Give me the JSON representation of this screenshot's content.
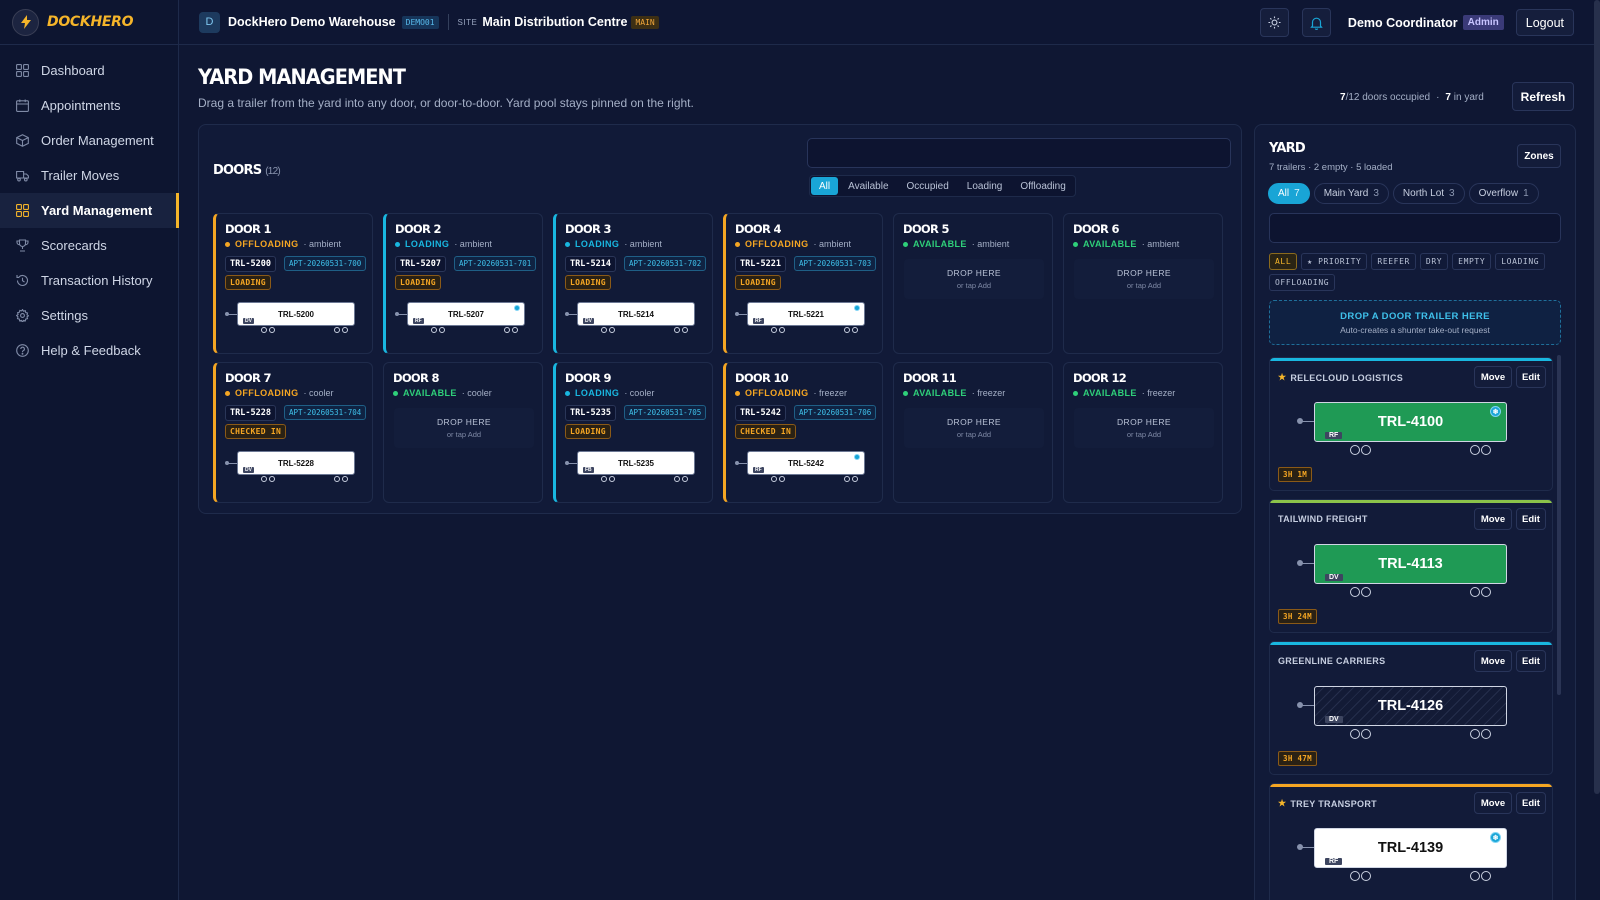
{
  "app": {
    "name": "DOCKHERO"
  },
  "sidebar": {
    "items": [
      {
        "label": "Dashboard",
        "icon": "grid-icon"
      },
      {
        "label": "Appointments",
        "icon": "calendar-icon"
      },
      {
        "label": "Order Management",
        "icon": "box-icon"
      },
      {
        "label": "Trailer Moves",
        "icon": "truck-icon"
      },
      {
        "label": "Yard Management",
        "icon": "grid-icon",
        "active": true
      },
      {
        "label": "Scorecards",
        "icon": "trophy-icon"
      },
      {
        "label": "Transaction History",
        "icon": "history-icon"
      },
      {
        "label": "Settings",
        "icon": "gear-icon"
      },
      {
        "label": "Help & Feedback",
        "icon": "help-icon"
      }
    ]
  },
  "topbar": {
    "warehouse_initial": "D",
    "warehouse_name": "DockHero Demo Warehouse",
    "warehouse_code": "DEMO01",
    "site_label": "SITE",
    "site_name": "Main Distribution Centre",
    "site_tag": "MAIN",
    "user_name": "Demo Coordinator",
    "user_role": "Admin",
    "logout_label": "Logout"
  },
  "page": {
    "title": "YARD MANAGEMENT",
    "subtitle": "Drag a trailer from the yard into any door, or door-to-door. Yard pool stays pinned on the right.",
    "doors_occupied": "7",
    "doors_total": "/12 doors occupied",
    "stats_sep": "·",
    "in_yard": "7",
    "in_yard_label": " in yard",
    "refresh_label": "Refresh"
  },
  "doors": {
    "title": "DOORS",
    "count": "(12)",
    "search_placeholder": "",
    "filters": [
      "All",
      "Available",
      "Occupied",
      "Loading",
      "Offloading"
    ],
    "active_filter": "All",
    "drop_text": "DROP HERE",
    "drop_sub": "or tap Add",
    "items": [
      {
        "name": "DOOR 1",
        "status": "OFFLOADING",
        "kind": "off",
        "zone": "· ambient",
        "trailer": "TRL-5200",
        "apt": "APT-20260531-700",
        "pill": "LOADING",
        "label": "DV",
        "reefer": false
      },
      {
        "name": "DOOR 2",
        "status": "LOADING",
        "kind": "load",
        "zone": "· ambient",
        "trailer": "TRL-5207",
        "apt": "APT-20260531-701",
        "pill": "LOADING",
        "label": "RF",
        "reefer": true
      },
      {
        "name": "DOOR 3",
        "status": "LOADING",
        "kind": "load",
        "zone": "· ambient",
        "trailer": "TRL-5214",
        "apt": "APT-20260531-702",
        "pill": "LOADING",
        "label": "DV",
        "reefer": false
      },
      {
        "name": "DOOR 4",
        "status": "OFFLOADING",
        "kind": "off",
        "zone": "· ambient",
        "trailer": "TRL-5221",
        "apt": "APT-20260531-703",
        "pill": "LOADING",
        "label": "RF",
        "reefer": true
      },
      {
        "name": "DOOR 5",
        "status": "AVAILABLE",
        "kind": "av",
        "zone": "· ambient"
      },
      {
        "name": "DOOR 6",
        "status": "AVAILABLE",
        "kind": "av",
        "zone": "· ambient"
      },
      {
        "name": "DOOR 7",
        "status": "OFFLOADING",
        "kind": "off",
        "zone": "· cooler",
        "trailer": "TRL-5228",
        "apt": "APT-20260531-704",
        "pill": "CHECKED IN",
        "label": "DV",
        "reefer": false
      },
      {
        "name": "DOOR 8",
        "status": "AVAILABLE",
        "kind": "av",
        "zone": "· cooler"
      },
      {
        "name": "DOOR 9",
        "status": "LOADING",
        "kind": "load",
        "zone": "· cooler",
        "trailer": "TRL-5235",
        "apt": "APT-20260531-705",
        "pill": "LOADING",
        "label": "FB",
        "reefer": false
      },
      {
        "name": "DOOR 10",
        "status": "OFFLOADING",
        "kind": "off",
        "zone": "· freezer",
        "trailer": "TRL-5242",
        "apt": "APT-20260531-706",
        "pill": "CHECKED IN",
        "label": "RF",
        "reefer": true
      },
      {
        "name": "DOOR 11",
        "status": "AVAILABLE",
        "kind": "av",
        "zone": "· freezer"
      },
      {
        "name": "DOOR 12",
        "status": "AVAILABLE",
        "kind": "av",
        "zone": "· freezer"
      }
    ]
  },
  "yard": {
    "title": "YARD",
    "summary": "7 trailers · 2 empty · 5 loaded",
    "zones_label": "Zones",
    "tabs": [
      {
        "label": "All",
        "count": "7",
        "active": true
      },
      {
        "label": "Main Yard",
        "count": "3"
      },
      {
        "label": "North Lot",
        "count": "3"
      },
      {
        "label": "Overflow",
        "count": "1"
      }
    ],
    "search_placeholder": "",
    "filters": [
      "ALL",
      "★ PRIORITY",
      "REEFER",
      "DRY",
      "EMPTY",
      "LOADING",
      "OFFLOADING"
    ],
    "active_filter": "ALL",
    "drop_title": "DROP A DOOR TRAILER HERE",
    "drop_sub": "Auto-creates a shunter take-out request",
    "move_label": "Move",
    "edit_label": "Edit",
    "cards": [
      {
        "carrier": "RELECLOUD LOGISTICS",
        "priority": true,
        "trailer": "TRL-4100",
        "label": "RF",
        "style": "green",
        "reefer": true,
        "dwell": "3H 1M",
        "accent": "#19b7e0"
      },
      {
        "carrier": "TAILWIND FREIGHT",
        "priority": false,
        "trailer": "TRL-4113",
        "label": "DV",
        "style": "green",
        "reefer": false,
        "dwell": "3H 24M",
        "accent": "#8bc34a"
      },
      {
        "carrier": "GREENLINE CARRIERS",
        "priority": false,
        "trailer": "TRL-4126",
        "label": "DV",
        "style": "empty",
        "reefer": false,
        "dwell": "3H 47M",
        "accent": "#19b7e0"
      },
      {
        "carrier": "TREY TRANSPORT",
        "priority": true,
        "trailer": "TRL-4139",
        "label": "RF",
        "style": "white",
        "reefer": true,
        "dwell": "",
        "accent": "#f5a623"
      }
    ]
  },
  "colors": {
    "accent": "#f5b52a",
    "cyan": "#19a5d6",
    "offloading": "#f5a623",
    "loading": "#19b7e0",
    "available": "#2fd07a"
  }
}
